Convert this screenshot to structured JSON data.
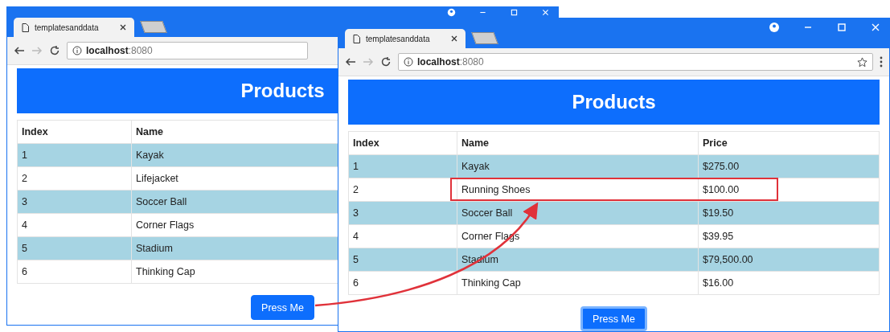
{
  "windows": [
    {
      "tab": {
        "title": "templatesanddata",
        "selected": true
      },
      "address": {
        "host": "localhost",
        "port": ":8080"
      },
      "heading": "Products",
      "table": {
        "columns": [
          "Index",
          "Name"
        ],
        "rows": [
          {
            "cells": [
              "1",
              "Kayak"
            ],
            "highlighted": false
          },
          {
            "cells": [
              "2",
              "Lifejacket"
            ],
            "highlighted": false
          },
          {
            "cells": [
              "3",
              "Soccer Ball"
            ],
            "highlighted": false
          },
          {
            "cells": [
              "4",
              "Corner Flags"
            ],
            "highlighted": false
          },
          {
            "cells": [
              "5",
              "Stadium"
            ],
            "highlighted": false
          },
          {
            "cells": [
              "6",
              "Thinking Cap"
            ],
            "highlighted": false
          }
        ]
      },
      "button": {
        "label": "Press Me",
        "focused": false
      }
    },
    {
      "tab": {
        "title": "templatesanddata",
        "selected": true
      },
      "address": {
        "host": "localhost",
        "port": ":8080"
      },
      "heading": "Products",
      "table": {
        "columns": [
          "Index",
          "Name",
          "Price"
        ],
        "rows": [
          {
            "cells": [
              "1",
              "Kayak",
              "$275.00"
            ],
            "highlighted": false
          },
          {
            "cells": [
              "2",
              "Running Shoes",
              "$100.00"
            ],
            "highlighted": true
          },
          {
            "cells": [
              "3",
              "Soccer Ball",
              "$19.50"
            ],
            "highlighted": false
          },
          {
            "cells": [
              "4",
              "Corner Flags",
              "$39.95"
            ],
            "highlighted": false
          },
          {
            "cells": [
              "5",
              "Stadium",
              "$79,500.00"
            ],
            "highlighted": false
          },
          {
            "cells": [
              "6",
              "Thinking Cap",
              "$16.00"
            ],
            "highlighted": false
          }
        ]
      },
      "button": {
        "label": "Press Me",
        "focused": true
      }
    }
  ]
}
